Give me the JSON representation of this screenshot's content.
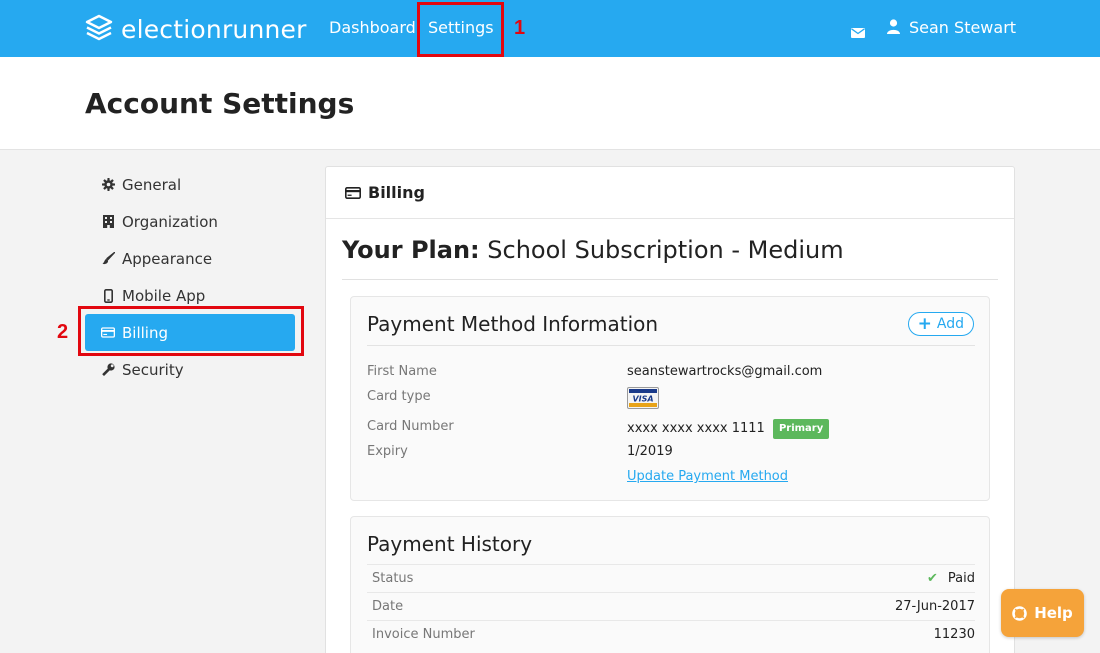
{
  "navbar": {
    "brand": "electionrunner",
    "links": [
      {
        "label": "Dashboard"
      },
      {
        "label": "Settings"
      }
    ],
    "user_name": "Sean Stewart"
  },
  "annotations": [
    "1",
    "2"
  ],
  "header": {
    "title": "Account Settings"
  },
  "sidebar": {
    "items": [
      {
        "label": "General",
        "icon": "gear-icon"
      },
      {
        "label": "Organization",
        "icon": "building-icon"
      },
      {
        "label": "Appearance",
        "icon": "brush-icon"
      },
      {
        "label": "Mobile App",
        "icon": "phone-icon"
      },
      {
        "label": "Billing",
        "icon": "credit-card-icon",
        "active": true
      },
      {
        "label": "Security",
        "icon": "wrench-icon"
      }
    ]
  },
  "panel": {
    "title": "Billing",
    "plan_label": "Your Plan:",
    "plan_name": "School Subscription - Medium",
    "payment_method": {
      "title": "Payment Method Information",
      "add_label": "Add",
      "fields": {
        "first_name_label": "First Name",
        "first_name_value": "seanstewartrocks@gmail.com",
        "card_type_label": "Card type",
        "card_type_value": "VISA",
        "card_number_label": "Card Number",
        "card_number_value": "xxxx xxxx xxxx 1111",
        "primary_badge": "Primary",
        "expiry_label": "Expiry",
        "expiry_value": "1/2019",
        "update_link": "Update Payment Method"
      }
    },
    "payment_history": {
      "title": "Payment History",
      "rows": [
        {
          "label": "Status",
          "value": "Paid"
        },
        {
          "label": "Date",
          "value": "27-Jun-2017"
        },
        {
          "label": "Invoice Number",
          "value": "11230"
        }
      ]
    }
  },
  "help": {
    "label": "Help"
  },
  "colors": {
    "accent": "#26a9f0",
    "annotation": "#e2070f",
    "help": "#f5a33a",
    "success": "#5cb85c"
  }
}
